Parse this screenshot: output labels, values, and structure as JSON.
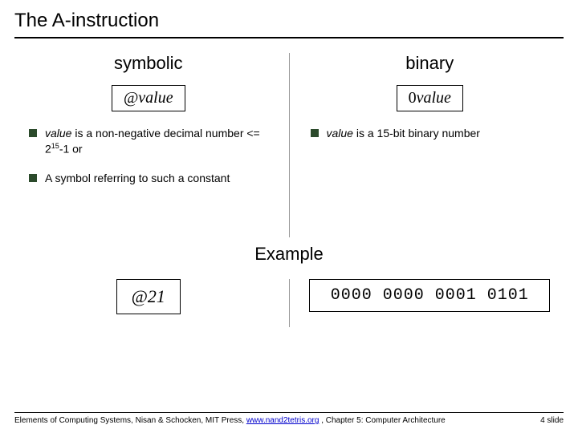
{
  "title": "The A-instruction",
  "left": {
    "heading": "symbolic",
    "box": "@value",
    "bullets": [
      {
        "pre": "",
        "it": "value",
        "post": " is a non-negative decimal number <= 2",
        "sup": "15",
        "post2": "-1 or"
      },
      {
        "pre": "A symbol referring to such a constant",
        "it": "",
        "post": "",
        "sup": "",
        "post2": ""
      }
    ]
  },
  "right": {
    "heading": "binary",
    "box": "0value",
    "bullets": [
      {
        "pre": "",
        "it": "value",
        "post": " is a 15-bit binary number",
        "sup": "",
        "post2": ""
      }
    ]
  },
  "example": {
    "label": "Example",
    "left_box": "@21",
    "right_box": "0000 0000 0001 0101"
  },
  "footer": {
    "text_pre": "Elements of Computing Systems, Nisan & Schocken, MIT Press, ",
    "link": "www.nand2tetris.org",
    "text_post": " , Chapter 5: Computer Architecture",
    "page": "4 slide"
  }
}
